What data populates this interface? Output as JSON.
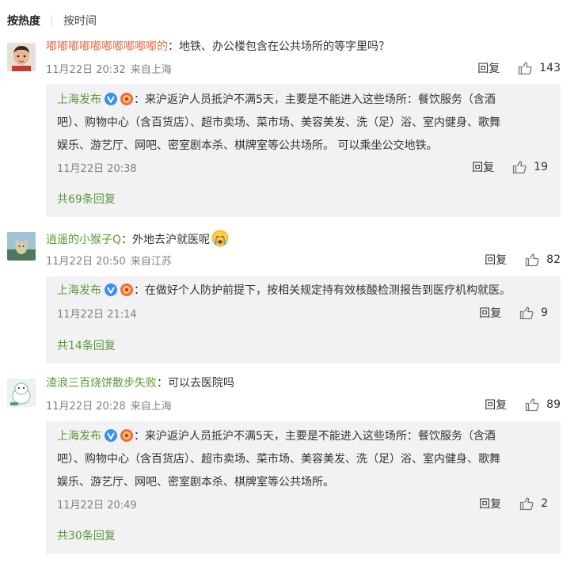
{
  "tabs": {
    "hot": "按热度",
    "time": "按时间"
  },
  "comments": [
    {
      "user": "嘟嘟嘟嘟嘟嘟嘟嘟嘟嘟的",
      "text": "地铁、办公楼包含在公共场所的等字里吗？",
      "time": "11月22日 20:32",
      "location": "来自上海",
      "reply_label": "回复",
      "likes": "143",
      "reply": {
        "user": "上海发布",
        "lines": [
          "来沪返沪人员抵沪不满5天，主要是不能进入这些场所：餐饮服务（含酒",
          "吧）、购物中心（含百货店）、超市卖场、菜市场、美容美发、洗（足）浴、室内健身、歌舞",
          "娱乐、游艺厅、网吧、密室剧本杀、棋牌室等公共场所。 可以乘坐公交地铁。"
        ],
        "time": "11月22日 20:38",
        "reply_label": "回复",
        "likes": "19"
      },
      "more": "共69条回复"
    },
    {
      "user": "逍遥的小猴子Q",
      "text": "外地去沪就医呢",
      "time": "11月22日 20:50",
      "location": "来自江苏",
      "reply_label": "回复",
      "likes": "82",
      "reply": {
        "user": "上海发布",
        "lines": [
          "在做好个人防护前提下，按相关规定持有效核酸检测报告到医疗机构就医。"
        ],
        "time": "11月22日 21:14",
        "reply_label": "回复",
        "likes": "9"
      },
      "more": "共14条回复"
    },
    {
      "user": "渣浪三百烧饼散步失败",
      "text": "可以去医院吗",
      "time": "11月22日 20:28",
      "location": "来自上海",
      "reply_label": "回复",
      "likes": "89",
      "reply": {
        "user": "上海发布",
        "lines": [
          "来沪返沪人员抵沪不满5天，主要是不能进入这些场所：餐饮服务（含酒",
          "吧）、购物中心（含百货店）、超市卖场、菜市场、美容美发、洗（足）浴、室内健身、歌舞",
          "娱乐、游艺厅、网吧、密室剧本杀、棋牌室等公共场所。"
        ],
        "time": "11月22日 20:49",
        "reply_label": "回复",
        "likes": "2"
      },
      "more": "共30条回复"
    }
  ],
  "colors": {
    "username_orange": "#eb7350",
    "username_green": "#5b9a34",
    "meta_gray": "#808080",
    "reply_bg": "#f2f2f5"
  },
  "icons": {
    "like": "thumbs-up-icon",
    "verified": "verified-v-icon",
    "crying": "crying-emoji-icon"
  }
}
